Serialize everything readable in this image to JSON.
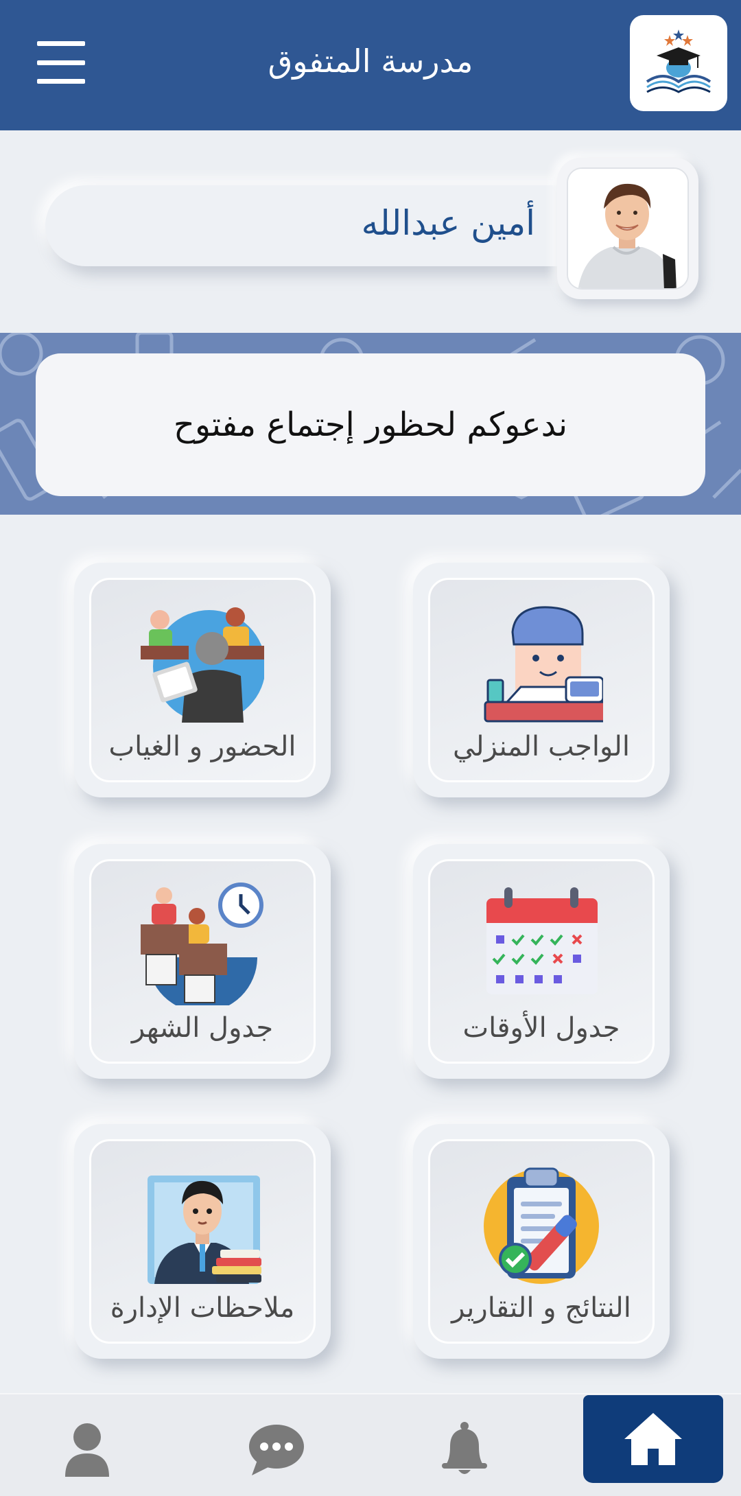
{
  "header": {
    "title": "مدرسة المتفوق",
    "menu_icon": "hamburger-menu-icon",
    "logo_icon": "school-logo-icon"
  },
  "profile": {
    "name": "أمين عبدالله",
    "avatar_icon": "student-avatar-photo"
  },
  "banner": {
    "message": "ندعوكم لحظور إجتماع مفتوح"
  },
  "tiles": [
    {
      "label": "الواجب المنزلي",
      "icon": "homework-icon"
    },
    {
      "label": "الحضور و الغياب",
      "icon": "attendance-icon"
    },
    {
      "label": "جدول الأوقات",
      "icon": "calendar-icon"
    },
    {
      "label": "جدول الشهر",
      "icon": "monthly-schedule-icon"
    },
    {
      "label": "النتائج و التقارير",
      "icon": "results-report-icon"
    },
    {
      "label": "ملاحظات الإدارة",
      "icon": "administration-notes-icon"
    }
  ],
  "bottom_nav": [
    {
      "name": "home",
      "icon": "home-icon",
      "active": true
    },
    {
      "name": "notifications",
      "icon": "bell-icon",
      "active": false
    },
    {
      "name": "messages",
      "icon": "chat-icon",
      "active": false
    },
    {
      "name": "profile",
      "icon": "user-icon",
      "active": false
    }
  ],
  "colors": {
    "header": "#2f5793",
    "banner": "#6c86b7",
    "nav_active": "#0f3c7a",
    "name_text": "#1f4f8c",
    "background": "#eceff3"
  }
}
